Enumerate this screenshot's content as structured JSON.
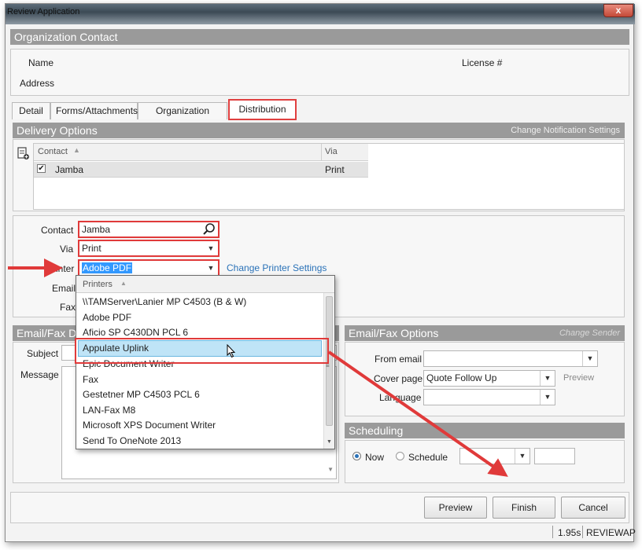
{
  "window": {
    "title": "Review Application",
    "close_label": "x"
  },
  "org_contact": {
    "header": "Organization Contact",
    "name_label": "Name",
    "license_label": "License #",
    "address_label": "Address"
  },
  "tabs": [
    {
      "label": "Detail"
    },
    {
      "label": "Forms/Attachments"
    },
    {
      "label": "Organization Contact"
    },
    {
      "label": "Distribution"
    }
  ],
  "delivery": {
    "header": "Delivery Options",
    "change_notification": "Change Notification Settings",
    "grid_headers": {
      "contact": "Contact",
      "via": "Via"
    },
    "rows": [
      {
        "checked": true,
        "contact": "Jamba",
        "via": "Print"
      }
    ]
  },
  "form": {
    "contact_label": "Contact",
    "contact_value": "Jamba",
    "via_label": "Via",
    "via_value": "Print",
    "printer_label": "Printer",
    "printer_value": "Adobe PDF",
    "change_printer": "Change Printer Settings",
    "email_label": "Email",
    "fax_label": "Fax"
  },
  "printers_popup": {
    "header": "Printers",
    "items": [
      "\\\\TAMServer\\Lanier MP C4503 (B & W)",
      "Adobe PDF",
      "Aficio SP C430DN PCL 6",
      "Appulate Uplink",
      "Epic Document Writer",
      "Fax",
      "Gestetner MP C4503 PCL 6",
      "LAN-Fax M8",
      "Microsoft XPS Document Writer",
      "Send To OneNote 2013"
    ],
    "selected": "Appulate Uplink"
  },
  "email_fax_details": {
    "header": "Email/Fax De",
    "subject_label": "Subject",
    "message_label": "Message"
  },
  "email_fax_options": {
    "header": "Email/Fax Options",
    "change_sender": "Change Sender",
    "from_email_label": "From email",
    "cover_page_label": "Cover page",
    "cover_page_value": "Quote Follow Up",
    "preview_link": "Preview",
    "language_label": "Language"
  },
  "scheduling": {
    "header": "Scheduling",
    "now_label": "Now",
    "schedule_label": "Schedule",
    "selected": "Now"
  },
  "buttons": {
    "preview": "Preview",
    "finish": "Finish",
    "cancel": "Cancel"
  },
  "status_bar": {
    "timing": "1.95s",
    "mode": "REVIEWAP"
  },
  "colors": {
    "highlight": "#e03a3a",
    "section_bar": "#9a9a9a",
    "selection": "#bfe4f7"
  }
}
